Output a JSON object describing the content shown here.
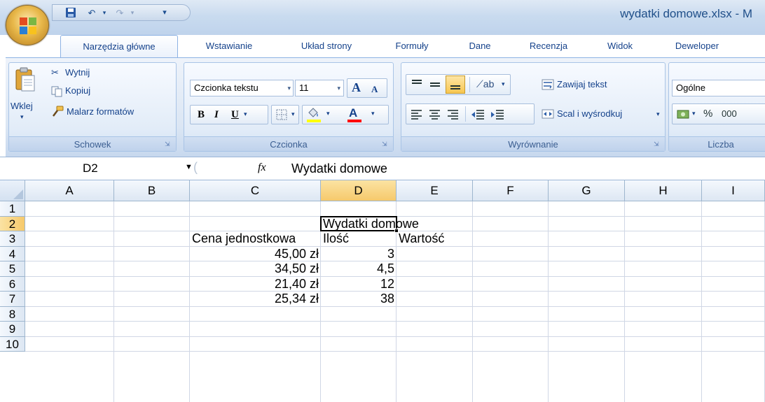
{
  "window": {
    "title": "wydatki domowe.xlsx - M"
  },
  "ribbon_tabs": [
    "Narzędzia główne",
    "Wstawianie",
    "Układ strony",
    "Formuły",
    "Dane",
    "Recenzja",
    "Widok",
    "Deweloper"
  ],
  "active_tab": "Narzędzia główne",
  "clipboard": {
    "paste": "Wklej",
    "cut": "Wytnij",
    "copy": "Kopiuj",
    "format_painter": "Malarz formatów",
    "label": "Schowek"
  },
  "font": {
    "name": "Czcionka tekstu",
    "size": "11",
    "bold": "B",
    "italic": "I",
    "underline": "U",
    "grow": "A",
    "shrink": "A",
    "label": "Czcionka",
    "fill_color": "#ffff00",
    "font_color": "#ff0000"
  },
  "alignment": {
    "wrap": "Zawijaj tekst",
    "merge": "Scal i wyśrodkuj",
    "label": "Wyrównanie"
  },
  "number": {
    "format": "Ogólne",
    "percent": "%",
    "thousands": "000",
    "label": "Liczba"
  },
  "formula_bar": {
    "name_box": "D2",
    "fx": "fx",
    "formula": "Wydatki domowe"
  },
  "sheet": {
    "columns": [
      "A",
      "B",
      "C",
      "D",
      "E",
      "F",
      "G",
      "H",
      "I"
    ],
    "rows": [
      "1",
      "2",
      "3",
      "4",
      "5",
      "6",
      "7",
      "8",
      "9",
      "10"
    ],
    "selected_column": "D",
    "selected_row": "2",
    "cells": {
      "D2": "Wydatki domowe",
      "C3": "Cena jednostkowa",
      "D3": "Ilość",
      "E3": "Wartość",
      "C4": "45,00 zł",
      "C5": "34,50 zł",
      "C6": "21,40 zł",
      "C7": "25,34 zł",
      "D4": "3",
      "D5": "4,5",
      "D6": "12",
      "D7": "38"
    }
  }
}
